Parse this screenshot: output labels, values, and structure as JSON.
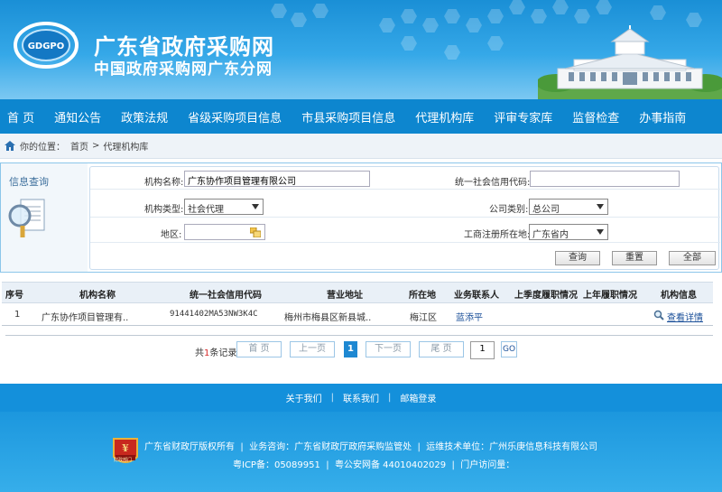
{
  "header": {
    "logo_text": "GDGPO",
    "title": "广东省政府采购网",
    "subtitle": "中国政府采购网广东分网"
  },
  "nav": {
    "items": [
      "首 页",
      "通知公告",
      "政策法规",
      "省级采购项目信息",
      "市县采购项目信息",
      "代理机构库",
      "评审专家库",
      "监督检查",
      "办事指南"
    ]
  },
  "breadcrumb": {
    "prefix": "你的位置：",
    "home": "首页",
    "separator": ">",
    "current": "代理机构库"
  },
  "search": {
    "panel_label": "信息查询",
    "org_name_label": "机构名称:",
    "org_name_value": "广东协作项目管理有限公司",
    "credit_code_label": "统一社会信用代码:",
    "credit_code_value": "",
    "org_type_label": "机构类型:",
    "org_type_value": "社会代理",
    "company_type_label": "公司类别:",
    "company_type_value": "总公司",
    "region_label": "地区:",
    "region_value": "",
    "reg_location_label": "工商注册所在地:",
    "reg_location_value": "广东省内",
    "query_button": "查询",
    "reset_button": "重置",
    "all_button": "全部"
  },
  "table": {
    "headers": [
      "序号",
      "机构名称",
      "统一社会信用代码",
      "营业地址",
      "所在地",
      "业务联系人",
      "上季度履职情况",
      "上年履职情况",
      "机构信息"
    ],
    "rows": [
      {
        "index": "1",
        "name": "广东协作项目管理有..",
        "code": "91441402MA53NW3K4C",
        "address": "梅州市梅县区新县城..",
        "location": "梅江区",
        "contact": "蓝添平",
        "last_quarter": "",
        "last_year": "",
        "info_link": "查看详情"
      }
    ]
  },
  "pager": {
    "total_prefix": "共",
    "total_count": "1",
    "total_suffix": "条记录",
    "first": "首 页",
    "prev": "上一页",
    "current": "1",
    "next": "下一页",
    "last": "尾 页",
    "page_input": "1",
    "go": "GO"
  },
  "footer": {
    "about": "关于我们",
    "contact": "联系我们",
    "mail": "邮箱登录",
    "sep": "|",
    "line1": "广东省财政厅版权所有  |  业务咨询：广东省财政厅政府采购监管处  |  运维技术单位：广州乐庚信息科技有限公司",
    "line2": "粤ICP备：05089951  |  粤公安网备 44010402029  |  门户访问量：",
    "seal_text": "财政部门"
  },
  "colors": {
    "nav_bg": "#0d86cf",
    "footer_bg": "#1490db",
    "current_page": "#1e88d2",
    "link": "#1a4f99"
  }
}
